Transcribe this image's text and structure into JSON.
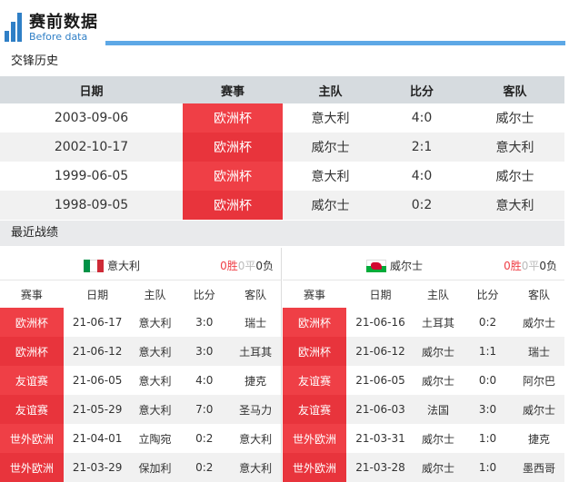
{
  "header": {
    "title": "赛前数据",
    "subtitle": "Before data"
  },
  "history": {
    "section_title": "交锋历史",
    "columns": [
      "日期",
      "赛事",
      "主队",
      "比分",
      "客队"
    ],
    "rows": [
      {
        "date": "2003-09-06",
        "comp": "欧洲杯",
        "home": "意大利",
        "score": "4:0",
        "away": "威尔士"
      },
      {
        "date": "2002-10-17",
        "comp": "欧洲杯",
        "home": "威尔士",
        "score": "2:1",
        "away": "意大利"
      },
      {
        "date": "1999-06-05",
        "comp": "欧洲杯",
        "home": "意大利",
        "score": "4:0",
        "away": "威尔士"
      },
      {
        "date": "1998-09-05",
        "comp": "欧洲杯",
        "home": "威尔士",
        "score": "0:2",
        "away": "意大利"
      }
    ]
  },
  "recent": {
    "section_title": "最近战绩",
    "columns": [
      "赛事",
      "日期",
      "主队",
      "比分",
      "客队"
    ],
    "left": {
      "team": "意大利",
      "record": {
        "win": "0胜",
        "draw": "0平",
        "lose": "0负"
      },
      "rows": [
        {
          "comp": "欧洲杯",
          "date": "21-06-17",
          "home": "意大利",
          "score": "3:0",
          "away": "瑞士"
        },
        {
          "comp": "欧洲杯",
          "date": "21-06-12",
          "home": "意大利",
          "score": "3:0",
          "away": "土耳其"
        },
        {
          "comp": "友谊赛",
          "date": "21-06-05",
          "home": "意大利",
          "score": "4:0",
          "away": "捷克"
        },
        {
          "comp": "友谊赛",
          "date": "21-05-29",
          "home": "意大利",
          "score": "7:0",
          "away": "圣马力"
        },
        {
          "comp": "世外欧洲",
          "date": "21-04-01",
          "home": "立陶宛",
          "score": "0:2",
          "away": "意大利"
        },
        {
          "comp": "世外欧洲",
          "date": "21-03-29",
          "home": "保加利",
          "score": "0:2",
          "away": "意大利"
        }
      ]
    },
    "right": {
      "team": "威尔士",
      "record": {
        "win": "0胜",
        "draw": "0平",
        "lose": "0负"
      },
      "rows": [
        {
          "comp": "欧洲杯",
          "date": "21-06-16",
          "home": "土耳其",
          "score": "0:2",
          "away": "威尔士"
        },
        {
          "comp": "欧洲杯",
          "date": "21-06-12",
          "home": "威尔士",
          "score": "1:1",
          "away": "瑞士"
        },
        {
          "comp": "友谊赛",
          "date": "21-06-05",
          "home": "威尔士",
          "score": "0:0",
          "away": "阿尔巴"
        },
        {
          "comp": "友谊赛",
          "date": "21-06-03",
          "home": "法国",
          "score": "3:0",
          "away": "威尔士"
        },
        {
          "comp": "世外欧洲",
          "date": "21-03-31",
          "home": "威尔士",
          "score": "1:0",
          "away": "捷克"
        },
        {
          "comp": "世外欧洲",
          "date": "21-03-28",
          "home": "威尔士",
          "score": "1:0",
          "away": "墨西哥"
        }
      ]
    }
  },
  "colors": {
    "accent_blue": "#2f7fc6",
    "line_blue": "#5da8e6",
    "comp_red": "#ef3f46",
    "comp_red_dark": "#e8343c",
    "header_gray": "#d6dbdf"
  },
  "icons": {
    "header": "bar-chart-icon",
    "left_flag": "italy-flag-icon",
    "right_flag": "wales-flag-icon"
  }
}
